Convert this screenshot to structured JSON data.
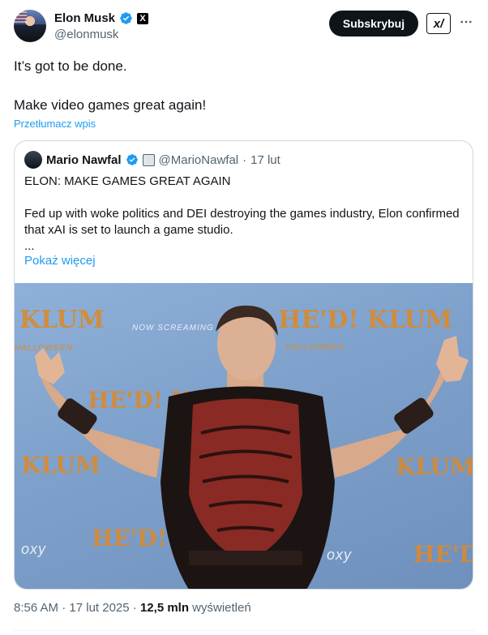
{
  "author": {
    "name": "Elon Musk",
    "handle": "@elonmusk",
    "x_badge": "X"
  },
  "actions": {
    "subscribe_label": "Subskrybuj",
    "xai_logo_text": "x/",
    "more_icon": "more-horizontal-icon"
  },
  "tweet": {
    "line1": "It’s got to be done.",
    "line2": "Make video games great again!",
    "translate_label": "Przetłumacz wpis"
  },
  "quote": {
    "name": "Mario Nawfal",
    "handle": "@MarioNawfal",
    "separator": "·",
    "date": "17 lut",
    "headline": "ELON: MAKE GAMES GREAT AGAIN",
    "body": "Fed up with woke politics and DEI destroying the games industry, Elon confirmed that xAI is set to launch a game studio.",
    "ellipsis": "...",
    "show_more": "Pokaż więcej"
  },
  "photo_backdrop": {
    "klum": "KLUM",
    "heidi": "HE'D! KLUM",
    "halloween": "HALLOWEEN",
    "now_screaming": "NOW SCREAMING",
    "heidi2": "HE'D!",
    "foxy": "oxy"
  },
  "footer": {
    "time": "8:56 AM",
    "dot": "·",
    "date": "17 lut 2025",
    "views_count": "12,5 mln",
    "views_label": "wyświetleń"
  },
  "colors": {
    "link": "#1d9bf0",
    "verified": "#1d9bf0",
    "text": "#0f1419",
    "muted": "#536471"
  }
}
